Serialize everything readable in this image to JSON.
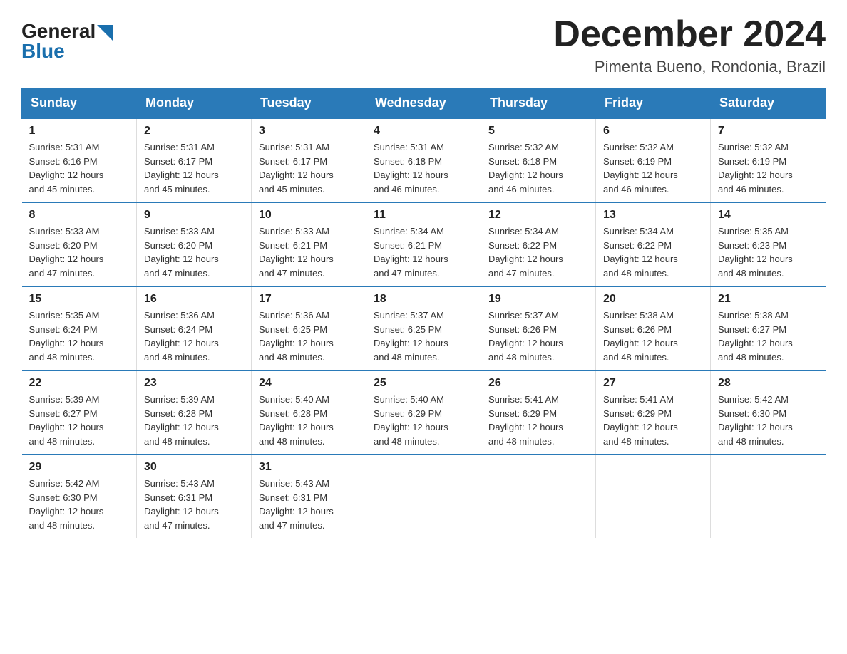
{
  "header": {
    "logo_general": "General",
    "logo_blue": "Blue",
    "title": "December 2024",
    "subtitle": "Pimenta Bueno, Rondonia, Brazil"
  },
  "weekdays": [
    "Sunday",
    "Monday",
    "Tuesday",
    "Wednesday",
    "Thursday",
    "Friday",
    "Saturday"
  ],
  "weeks": [
    [
      {
        "day": "1",
        "sunrise": "5:31 AM",
        "sunset": "6:16 PM",
        "daylight": "12 hours and 45 minutes."
      },
      {
        "day": "2",
        "sunrise": "5:31 AM",
        "sunset": "6:17 PM",
        "daylight": "12 hours and 45 minutes."
      },
      {
        "day": "3",
        "sunrise": "5:31 AM",
        "sunset": "6:17 PM",
        "daylight": "12 hours and 45 minutes."
      },
      {
        "day": "4",
        "sunrise": "5:31 AM",
        "sunset": "6:18 PM",
        "daylight": "12 hours and 46 minutes."
      },
      {
        "day": "5",
        "sunrise": "5:32 AM",
        "sunset": "6:18 PM",
        "daylight": "12 hours and 46 minutes."
      },
      {
        "day": "6",
        "sunrise": "5:32 AM",
        "sunset": "6:19 PM",
        "daylight": "12 hours and 46 minutes."
      },
      {
        "day": "7",
        "sunrise": "5:32 AM",
        "sunset": "6:19 PM",
        "daylight": "12 hours and 46 minutes."
      }
    ],
    [
      {
        "day": "8",
        "sunrise": "5:33 AM",
        "sunset": "6:20 PM",
        "daylight": "12 hours and 47 minutes."
      },
      {
        "day": "9",
        "sunrise": "5:33 AM",
        "sunset": "6:20 PM",
        "daylight": "12 hours and 47 minutes."
      },
      {
        "day": "10",
        "sunrise": "5:33 AM",
        "sunset": "6:21 PM",
        "daylight": "12 hours and 47 minutes."
      },
      {
        "day": "11",
        "sunrise": "5:34 AM",
        "sunset": "6:21 PM",
        "daylight": "12 hours and 47 minutes."
      },
      {
        "day": "12",
        "sunrise": "5:34 AM",
        "sunset": "6:22 PM",
        "daylight": "12 hours and 47 minutes."
      },
      {
        "day": "13",
        "sunrise": "5:34 AM",
        "sunset": "6:22 PM",
        "daylight": "12 hours and 48 minutes."
      },
      {
        "day": "14",
        "sunrise": "5:35 AM",
        "sunset": "6:23 PM",
        "daylight": "12 hours and 48 minutes."
      }
    ],
    [
      {
        "day": "15",
        "sunrise": "5:35 AM",
        "sunset": "6:24 PM",
        "daylight": "12 hours and 48 minutes."
      },
      {
        "day": "16",
        "sunrise": "5:36 AM",
        "sunset": "6:24 PM",
        "daylight": "12 hours and 48 minutes."
      },
      {
        "day": "17",
        "sunrise": "5:36 AM",
        "sunset": "6:25 PM",
        "daylight": "12 hours and 48 minutes."
      },
      {
        "day": "18",
        "sunrise": "5:37 AM",
        "sunset": "6:25 PM",
        "daylight": "12 hours and 48 minutes."
      },
      {
        "day": "19",
        "sunrise": "5:37 AM",
        "sunset": "6:26 PM",
        "daylight": "12 hours and 48 minutes."
      },
      {
        "day": "20",
        "sunrise": "5:38 AM",
        "sunset": "6:26 PM",
        "daylight": "12 hours and 48 minutes."
      },
      {
        "day": "21",
        "sunrise": "5:38 AM",
        "sunset": "6:27 PM",
        "daylight": "12 hours and 48 minutes."
      }
    ],
    [
      {
        "day": "22",
        "sunrise": "5:39 AM",
        "sunset": "6:27 PM",
        "daylight": "12 hours and 48 minutes."
      },
      {
        "day": "23",
        "sunrise": "5:39 AM",
        "sunset": "6:28 PM",
        "daylight": "12 hours and 48 minutes."
      },
      {
        "day": "24",
        "sunrise": "5:40 AM",
        "sunset": "6:28 PM",
        "daylight": "12 hours and 48 minutes."
      },
      {
        "day": "25",
        "sunrise": "5:40 AM",
        "sunset": "6:29 PM",
        "daylight": "12 hours and 48 minutes."
      },
      {
        "day": "26",
        "sunrise": "5:41 AM",
        "sunset": "6:29 PM",
        "daylight": "12 hours and 48 minutes."
      },
      {
        "day": "27",
        "sunrise": "5:41 AM",
        "sunset": "6:29 PM",
        "daylight": "12 hours and 48 minutes."
      },
      {
        "day": "28",
        "sunrise": "5:42 AM",
        "sunset": "6:30 PM",
        "daylight": "12 hours and 48 minutes."
      }
    ],
    [
      {
        "day": "29",
        "sunrise": "5:42 AM",
        "sunset": "6:30 PM",
        "daylight": "12 hours and 48 minutes."
      },
      {
        "day": "30",
        "sunrise": "5:43 AM",
        "sunset": "6:31 PM",
        "daylight": "12 hours and 47 minutes."
      },
      {
        "day": "31",
        "sunrise": "5:43 AM",
        "sunset": "6:31 PM",
        "daylight": "12 hours and 47 minutes."
      },
      null,
      null,
      null,
      null
    ]
  ]
}
